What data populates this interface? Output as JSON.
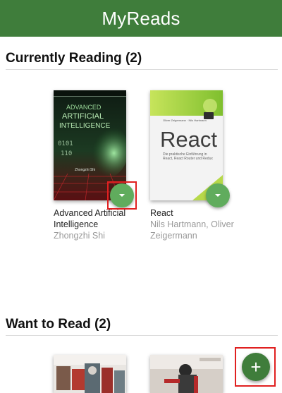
{
  "app": {
    "title": "MyReads"
  },
  "shelves": [
    {
      "title": "Currently Reading (2)",
      "books": [
        {
          "title_lines": [
            "Advanced Artificial",
            "Intelligence"
          ],
          "author_lines": [
            "Zhongzhi Shi"
          ],
          "cover": {
            "top_lines": [
              "ADVANCED",
              "ARTIFICIAL",
              "INTELLIGENCE"
            ],
            "author": "Zhongzhi Shi"
          }
        },
        {
          "title_lines": [
            "React"
          ],
          "author_lines": [
            "Nils Hartmann, Oliver",
            "Zeigermann"
          ],
          "cover": {
            "heading": "React",
            "authors_small": "Oliver Zeigermann · Nils Hartmann",
            "subtitle": "Die praktische Einführung in React, React Router und Redux"
          }
        }
      ]
    },
    {
      "title": "Want to Read (2)",
      "books": [
        {
          "cover": {}
        },
        {
          "cover": {}
        }
      ]
    }
  ],
  "colors": {
    "header": "#3f7d3b",
    "accent": "#60ac5d",
    "highlight": "#e02020"
  },
  "icons": {
    "shelf_changer": "caret-down-icon",
    "add": "plus-icon"
  },
  "add_button": {
    "label": "+"
  }
}
